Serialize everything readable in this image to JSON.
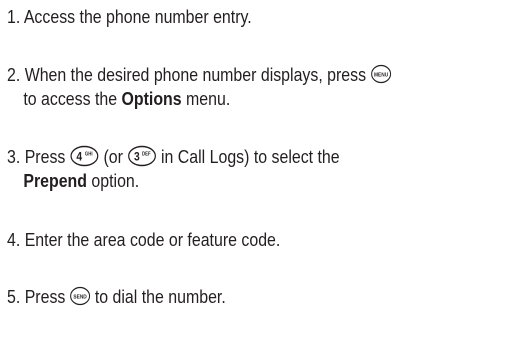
{
  "steps": [
    {
      "number": "1.",
      "text": "Access the phone number entry."
    },
    {
      "number": "2.",
      "part1": "When the desired phone number displays, press",
      "key": "MENU",
      "part2": "to access the",
      "bold": "Options",
      "part3": "menu."
    },
    {
      "number": "3.",
      "part1": "Press",
      "key1_main": "4",
      "key1_sub": "GHI",
      "part2": "(or",
      "key2_main": "3",
      "key2_sub": "DEF",
      "part3": "in Call Logs)  to select the",
      "bold": "Prepend",
      "part4": "option."
    },
    {
      "number": "4.",
      "text": "Enter the area code or feature code."
    },
    {
      "number": "5.",
      "part1": "Press",
      "key": "SEND",
      "part2": "to dial the number."
    }
  ],
  "colors": {
    "text": "#231f20",
    "key_outline": "#231f20"
  }
}
